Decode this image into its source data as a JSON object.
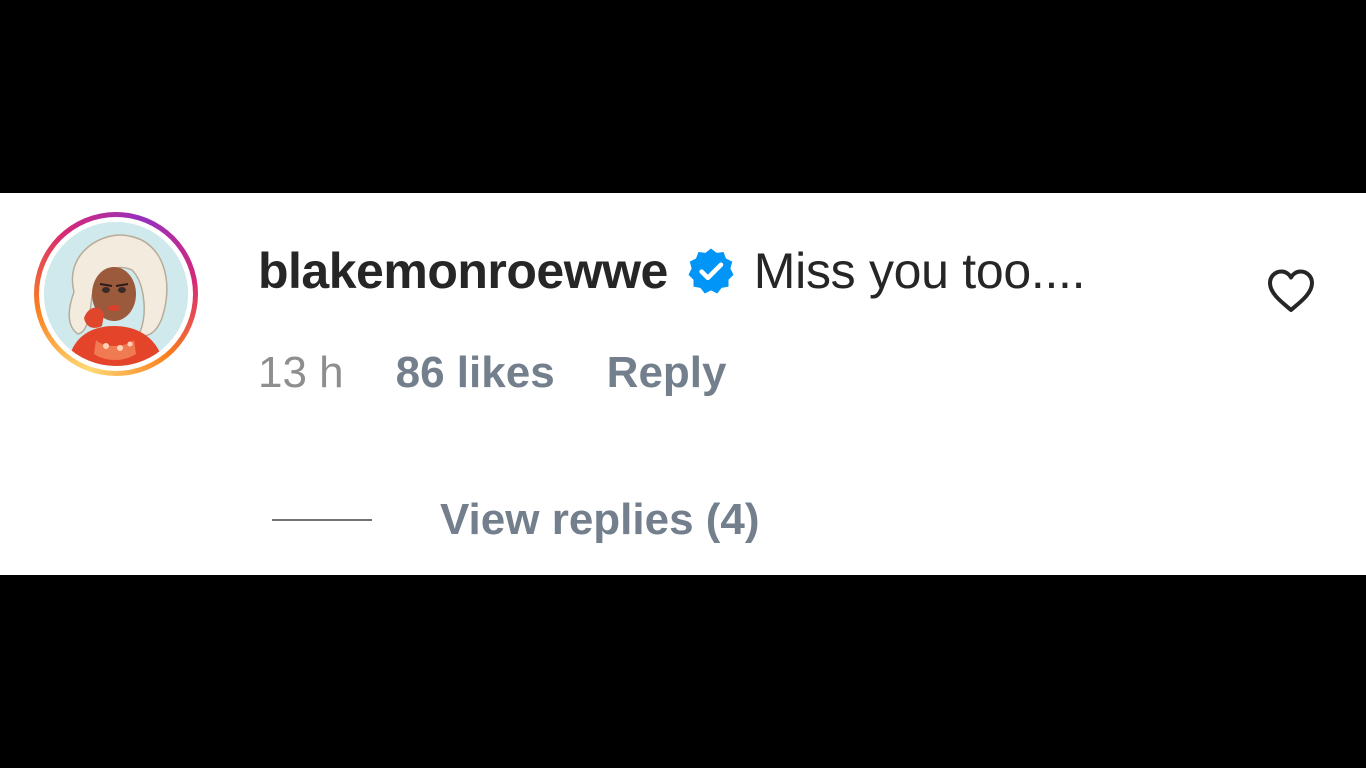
{
  "comment": {
    "username": "blakemonroewwe",
    "verified_icon": "verified-badge-icon",
    "text": "Miss you too....",
    "time": "13 h",
    "likes": "86 likes",
    "reply_label": "Reply",
    "like_icon": "heart-outline-icon"
  },
  "replies": {
    "label": "View replies (4)"
  },
  "colors": {
    "verified_blue": "#0095f6",
    "text_primary": "#262626",
    "text_secondary": "#737f8c"
  }
}
